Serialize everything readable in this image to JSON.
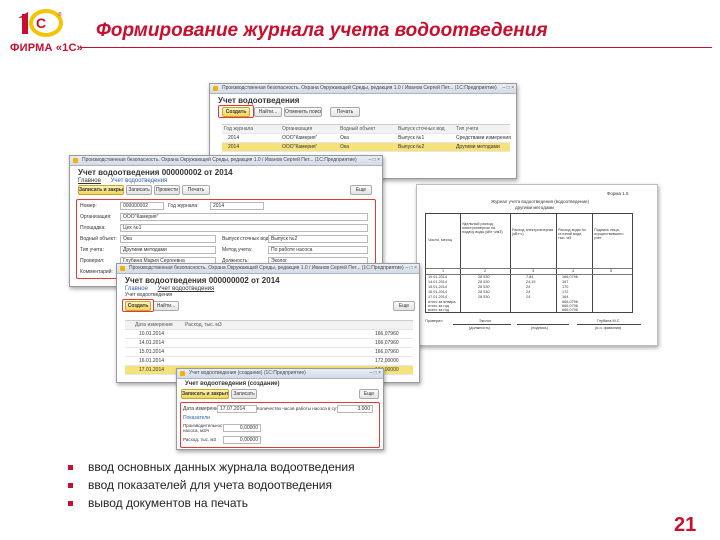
{
  "header": {
    "logo_firm_text": "ФИРМА «1С»",
    "title": "Формирование журнала учета водоотведения",
    "page_number": "21",
    "accent_color": "#c8102e"
  },
  "bullets": [
    "ввод основных данных журнала водоотведения",
    "ввод показателей для учета водоотведения",
    "вывод документов на печать"
  ],
  "list_window": {
    "title_bar": "Производственная безопасность. Охрана Окружающей Среды, редакция 1.0 / Иванов Сергей Пет... (1С:Предприятие)",
    "header": "Учет водоотведения",
    "toolbar": {
      "create": "Создать",
      "find": "Найти...",
      "cancel_search": "Отменить поиск",
      "print": "Печать"
    },
    "columns": [
      "Год журнала",
      "Организация",
      "Водный объект",
      "Выпуск сточных вод",
      "Тип учета"
    ],
    "rows": [
      [
        "2014",
        "ООО\"Камерия\"",
        "Ока",
        "Выпуск №1",
        "Средствами измерения"
      ],
      [
        "2014",
        "ООО\"Камерия\"",
        "Ока",
        "Выпуск №2",
        "Другими методами"
      ]
    ]
  },
  "doc_window": {
    "title_bar": "Производственная безопасность. Охрана Окружающей Среды, редакция 1.0 / Иванов Сергей Пет... (1С:Предприятие)",
    "header": "Учет водоотведения 000000002 от 2014",
    "tabs": [
      "Главное",
      "Учет водоотведения"
    ],
    "toolbar": {
      "save_close": "Записать и закрыть",
      "write": "Записать",
      "post": "Провести",
      "print": "Печать",
      "more": "Еще"
    },
    "fields": {
      "number_label": "Номер:",
      "number_value": "000000002",
      "year_label": "Год журнала:",
      "year_value": "2014",
      "org_label": "Организация:",
      "org_value": "ООО\"Камерия\"",
      "site_label": "Площадка:",
      "site_value": "Цех №1",
      "water_label": "Водный объект:",
      "water_value": "Ока",
      "outlet_label": "Выпуск сточных вод:",
      "outlet_value": "Выпуск №2",
      "type_label": "Тип учета:",
      "type_value": "Другими методами",
      "method_label": "Метод учета:",
      "method_value": "По работе насоса",
      "checked_label": "Проверил:",
      "checked_value": "Глубина Мария Сергеевна",
      "position_label": "Должность:",
      "position_value": "Эколог",
      "comment_label": "Комментарий:"
    }
  },
  "table_window": {
    "title_bar": "Производственная безопасность. Охрана Окружающей Среды, редакция 1.0 / Иванов Сергей Пет... (1С:Предприятие)",
    "header": "Учет водоотведения 000000002 от 2014",
    "tabs": [
      "Главное",
      "Учет водоотведения"
    ],
    "subheader": "Учет водоотведения",
    "toolbar": {
      "create": "Создать",
      "find": "Найти...",
      "more": "Еще"
    },
    "columns": [
      "Дата измерения",
      "Расход, тыс. м3"
    ],
    "rows": [
      [
        "10.01.2014",
        "166,07960"
      ],
      [
        "14.01.2014",
        "166,07960"
      ],
      [
        "15.01.2014",
        "166,07960"
      ],
      [
        "16.01.2014",
        "172,00000"
      ],
      [
        "17.01.2014",
        "164,00000"
      ]
    ]
  },
  "create_window": {
    "title_bar": "Учет водоотведения (создание) (1С:Предприятие)",
    "header": "Учет водоотведения (создание)",
    "toolbar": {
      "save_close": "Записать и закрыть",
      "write": "Записать",
      "more": "Еще"
    },
    "fields": {
      "date_label": "Дата измерения:",
      "date_value": "17.07.2014",
      "hours_label": "Количество часов работы насоса в сутки, ч:",
      "hours_value": "3,000",
      "section_label": "Показатели",
      "productivity_label": "Производительность насоса, м3/ч",
      "productivity_value": "0,00000",
      "flow_label": "Расход, тыс. м3",
      "flow_value": "0,00000"
    }
  },
  "print_document": {
    "form_label": "Форма 1.5",
    "title_line1": "Журнал учета водоотведения (водоотведение)",
    "title_line2": "другими методами",
    "columns": [
      "Число, месяц",
      "Удельный расход электроэнергии на подачу воды (кВт·ч/м3)",
      "Расход электроэнергии (кВт·ч)",
      "Расход воды по сточной воде, тыс. м3",
      "Подпись лица, осуществившего учет"
    ],
    "col_numbers": [
      "1",
      "2",
      "3",
      "4",
      "5"
    ],
    "rows": [
      [
        "10.01.2014",
        "28 530",
        "7,84",
        "166,0796",
        ""
      ],
      [
        "14.01.2014",
        "28 530",
        "24,15",
        "167",
        ""
      ],
      [
        "15.01.2014",
        "28 530",
        "24",
        "170",
        ""
      ],
      [
        "16.01.2014",
        "28 530",
        "24",
        "172",
        ""
      ],
      [
        "17.01.2014",
        "28 530",
        "24",
        "164",
        ""
      ]
    ],
    "totals": [
      [
        "итого за январь",
        "666,0796"
      ],
      [
        "итого за год",
        "666,0796"
      ],
      [
        "всего за год",
        "666,0796"
      ]
    ],
    "signature": {
      "label": "Проверил",
      "position": "Эколог",
      "position_caption": "(должность)",
      "sign_caption": "(подпись)",
      "name": "Глубина М.С",
      "name_caption": "(и.о. фамилия)"
    }
  }
}
